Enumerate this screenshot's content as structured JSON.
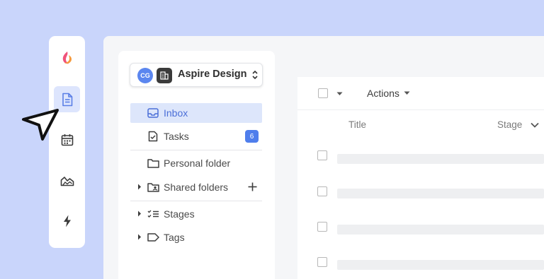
{
  "rail": {
    "items": [
      {
        "name": "app-logo",
        "active": false
      },
      {
        "name": "documents",
        "active": true
      },
      {
        "name": "calendar",
        "active": false
      },
      {
        "name": "reports",
        "active": false
      },
      {
        "name": "automations",
        "active": false
      }
    ]
  },
  "workspace": {
    "initials": "CG",
    "name": "Aspire Design"
  },
  "nav": {
    "inbox": "Inbox",
    "tasks": "Tasks",
    "tasks_count": "6",
    "personal_folder": "Personal folder",
    "shared_folders": "Shared folders",
    "stages": "Stages",
    "tags": "Tags"
  },
  "table": {
    "actions_label": "Actions",
    "columns": [
      "Title",
      "Stage"
    ],
    "row_count": 4
  },
  "colors": {
    "background": "#c9d5fb",
    "accent": "#4f7eec",
    "active_row": "#dde6fb",
    "logo": "#e8465b"
  }
}
